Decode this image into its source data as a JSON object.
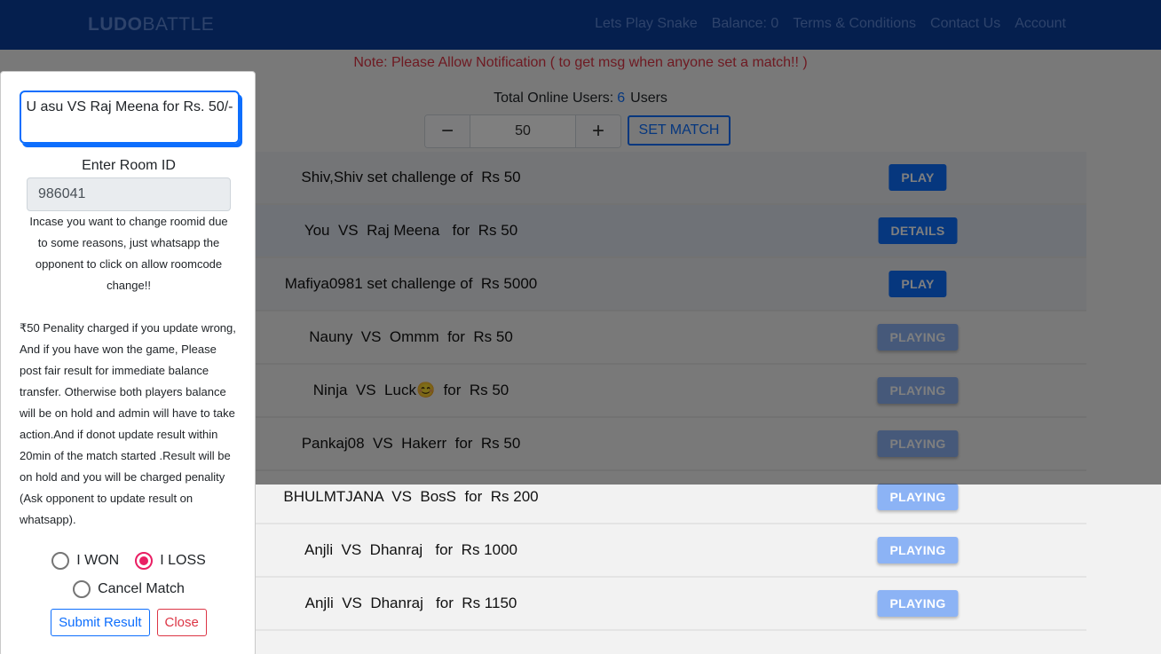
{
  "navbar": {
    "brand_bold": "LUDO",
    "brand_light": "BATTLE",
    "links": [
      "Lets Play Snake",
      "Balance: 0",
      "Terms & Conditions",
      "Contact Us",
      "Account"
    ]
  },
  "notice": "Note: Please Allow Notification ( to get msg when anyone set a match!! )",
  "online": {
    "label": "Total Online Users:",
    "count": "6",
    "suffix": "Users"
  },
  "stepper": {
    "minus": "−",
    "value": "50",
    "plus": "+"
  },
  "set_match_label": "SET MATCH",
  "matches": [
    {
      "text": "Shiv,Shiv set challenge of  Rs 50",
      "button": "PLAY",
      "type": "play"
    },
    {
      "text": "You  VS  Raj Meena   for  Rs 50",
      "button": "DETAILS",
      "type": "details"
    },
    {
      "text": "Mafiya0981 set challenge of  Rs 5000",
      "button": "PLAY",
      "type": "play"
    },
    {
      "text": "Nauny  VS  Ommm  for  Rs 50",
      "button": "PLAYING",
      "type": "playing"
    },
    {
      "text": "Ninja  VS  Luck😊  for  Rs 50",
      "button": "PLAYING",
      "type": "playing"
    },
    {
      "text": "Pankaj08  VS  Hakerr  for  Rs 50",
      "button": "PLAYING",
      "type": "playing"
    },
    {
      "text": "BHULMTJANA  VS  BosS  for  Rs 200",
      "button": "PLAYING",
      "type": "playing"
    },
    {
      "text": "Anjli  VS  Dhanraj   for  Rs 1000",
      "button": "PLAYING",
      "type": "playing"
    },
    {
      "text": "Anjli  VS  Dhanraj   for  Rs 1150",
      "button": "PLAYING",
      "type": "playing"
    }
  ],
  "modal": {
    "title": "U asu VS Raj Meena for Rs. 50/-",
    "room_label": "Enter Room ID",
    "room_value": "986041",
    "room_note": "Incase you want to change roomid due to some reasons, just whatsapp the opponent to click on allow roomcode change!!",
    "penalty_text": "₹50 Penality charged if you update wrong, And if you have won the game, Please post fair result for immediate balance transfer. Otherwise both players balance will be on hold and admin will have to take action.And if donot update result within 20min of the match started .Result will be on hold and you will be charged penality (Ask opponent to update result on whatsapp).",
    "options": {
      "won": "I WON",
      "loss": "I LOSS",
      "cancel": "Cancel Match"
    },
    "selected": "loss",
    "submit_label": "Submit Result",
    "close_label": "Close"
  },
  "colors": {
    "primary": "#0d6efd",
    "danger": "#dc3545",
    "radio_selected": "#e91e63",
    "navbar": "#0b3f9c"
  }
}
